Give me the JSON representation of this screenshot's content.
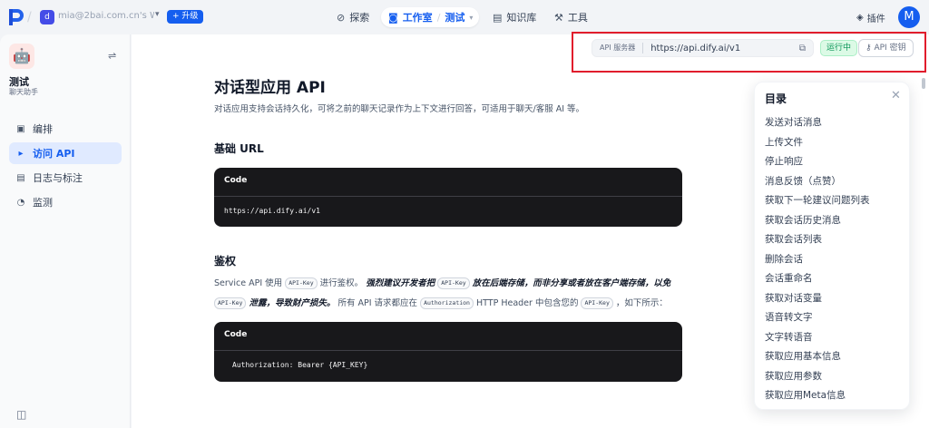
{
  "topbar": {
    "workspace_avatar": "d",
    "workspace_name": "mia@2bai.com.cn's Wor...",
    "upgrade_label": "升级",
    "nav": {
      "explore": "探索",
      "studio": "工作室",
      "app": "测试",
      "knowledge": "知识库",
      "tools": "工具"
    },
    "plugin": "插件",
    "user_avatar": "M"
  },
  "sidebar": {
    "app_name": "测试",
    "app_type": "聊天助手",
    "items": [
      {
        "label": "编排",
        "icon": "layout-icon"
      },
      {
        "label": "访问 API",
        "icon": "terminal-icon",
        "active": true
      },
      {
        "label": "日志与标注",
        "icon": "file-list-icon"
      },
      {
        "label": "监测",
        "icon": "gauge-icon"
      }
    ]
  },
  "apibar": {
    "tag": "API 服务器",
    "url": "https://api.dify.ai/v1",
    "status": "运行中",
    "key_label": "API 密钥"
  },
  "doc": {
    "title": "对话型应用 API",
    "intro": "对话应用支持会话持久化，可将之前的聊天记录作为上下文进行回答，可适用于聊天/客服 AI 等。",
    "base_url_heading": "基础 URL",
    "code_label": "Code",
    "base_url_code": "https://api.dify.ai/v1",
    "auth_heading": "鉴权",
    "auth": {
      "p1": "Service API 使用",
      "chip1": "API-Key",
      "p2": "进行鉴权。",
      "s1": "强烈建议开发者把",
      "chip2": "API-Key",
      "s2": "放在后端存储，而非分享或者放在客户端存储，以免",
      "chip3": "API-Key",
      "s3": "泄露，导致财产损失。",
      "p3": "所有 API 请求都应在",
      "chip4": "Authorization",
      "p4": "HTTP Header 中包含您的",
      "chip5": "API-Key",
      "p5": "，如下所示："
    },
    "auth_code": "Authorization: Bearer {API_KEY}"
  },
  "toc": {
    "title": "目录",
    "items": [
      "发送对话消息",
      "上传文件",
      "停止响应",
      "消息反馈（点赞）",
      "获取下一轮建议问题列表",
      "获取会话历史消息",
      "获取会话列表",
      "删除会话",
      "会话重命名",
      "获取对话变量",
      "语音转文字",
      "文字转语音",
      "获取应用基本信息",
      "获取应用参数",
      "获取应用Meta信息"
    ]
  },
  "colors": {
    "accent": "#155eef",
    "highlight_border": "#e11d2c",
    "running_green": "#079455"
  }
}
